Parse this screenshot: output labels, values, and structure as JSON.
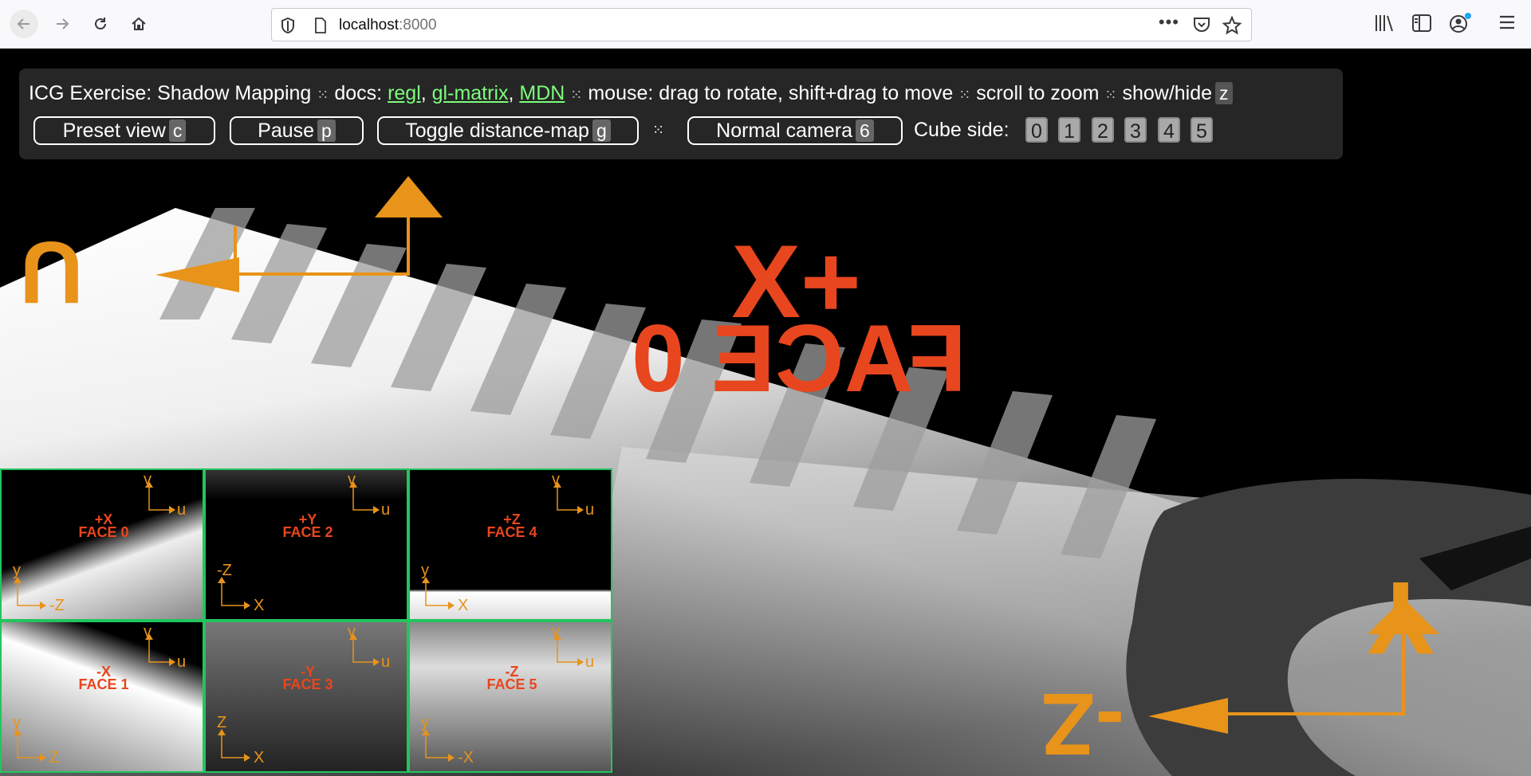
{
  "browser": {
    "url_host": "localhost",
    "url_port": ":8000"
  },
  "overlay": {
    "title": "ICG Exercise: Shadow Mapping",
    "docs_label": "docs:",
    "links": [
      "regl",
      "gl-matrix",
      "MDN"
    ],
    "mouse_hint": "mouse: drag to rotate, shift+drag to move",
    "scroll_hint": "scroll to zoom",
    "showhide_label": "show/hide",
    "showhide_key": "z",
    "separator": "⁙"
  },
  "buttons": [
    {
      "label": "Preset view",
      "key": "c"
    },
    {
      "label": "Pause",
      "key": "p"
    },
    {
      "label": "Toggle distance-map",
      "key": "g"
    },
    {
      "label": "Normal camera",
      "key": "6"
    }
  ],
  "cube_side": {
    "label": "Cube side:",
    "options": [
      "0",
      "1",
      "2",
      "3",
      "4",
      "5"
    ]
  },
  "scene_labels": {
    "big_axis": "+X",
    "big_face": "FACE 0",
    "big_u": "U",
    "big_v": "V",
    "big_y": "Y",
    "big_neg_z": "-Z"
  },
  "cube_faces": [
    {
      "axis": "+X",
      "face": "FACE 0",
      "u": "u",
      "v": "v",
      "a": "y",
      "b": "-Z"
    },
    {
      "axis": "+Y",
      "face": "FACE 2",
      "u": "u",
      "v": "v",
      "a": "-Z",
      "b": "X"
    },
    {
      "axis": "+Z",
      "face": "FACE 4",
      "u": "u",
      "v": "v",
      "a": "y",
      "b": "X"
    },
    {
      "axis": "-X",
      "face": "FACE 1",
      "u": "u",
      "v": "v",
      "a": "y",
      "b": "Z"
    },
    {
      "axis": "-Y",
      "face": "FACE 3",
      "u": "u",
      "v": "v",
      "a": "Z",
      "b": "X"
    },
    {
      "axis": "-Z",
      "face": "FACE 5",
      "u": "u",
      "v": "v",
      "a": "y",
      "b": "-X"
    }
  ],
  "colors": {
    "accent_orange": "#E8931A",
    "face_red": "#E8461E",
    "link_green": "#7CFC7C",
    "grid_border": "#22c55e"
  }
}
